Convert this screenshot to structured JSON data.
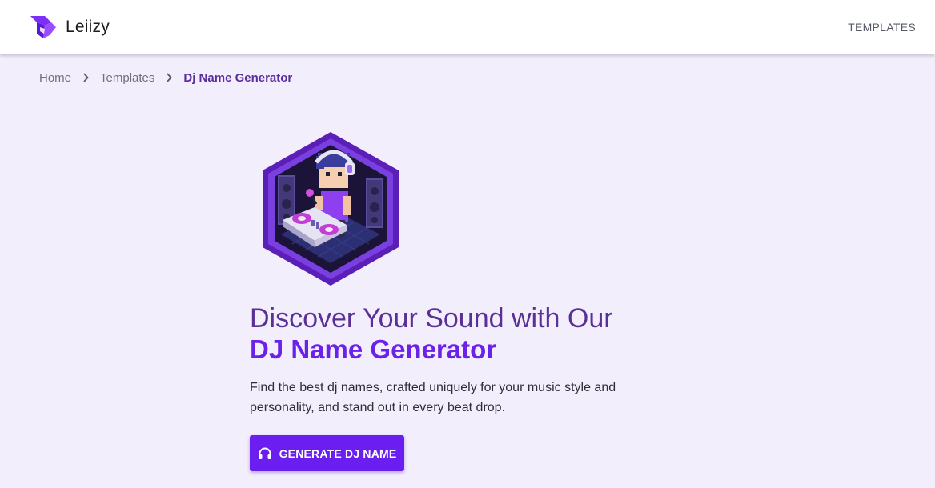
{
  "header": {
    "brand_name": "Leiizy",
    "nav": [
      {
        "label": "TEMPLATES"
      }
    ]
  },
  "breadcrumb": {
    "items": [
      {
        "label": "Home"
      },
      {
        "label": "Templates"
      },
      {
        "label": "Dj Name Generator"
      }
    ]
  },
  "hero": {
    "title_line1": "Discover Your Sound with Our",
    "title_line2": "DJ Name Generator",
    "description": "Find the best dj names, crafted uniquely for your music style and personality, and stand out in every beat drop.",
    "cta_label": "GENERATE DJ NAME",
    "cta_icon": "headphones-icon",
    "image_icon": "dj-illustration-icon"
  },
  "colors": {
    "brand_purple": "#6a1ff0",
    "title_purple": "#5a2f96",
    "page_background": "#f2eefc"
  }
}
